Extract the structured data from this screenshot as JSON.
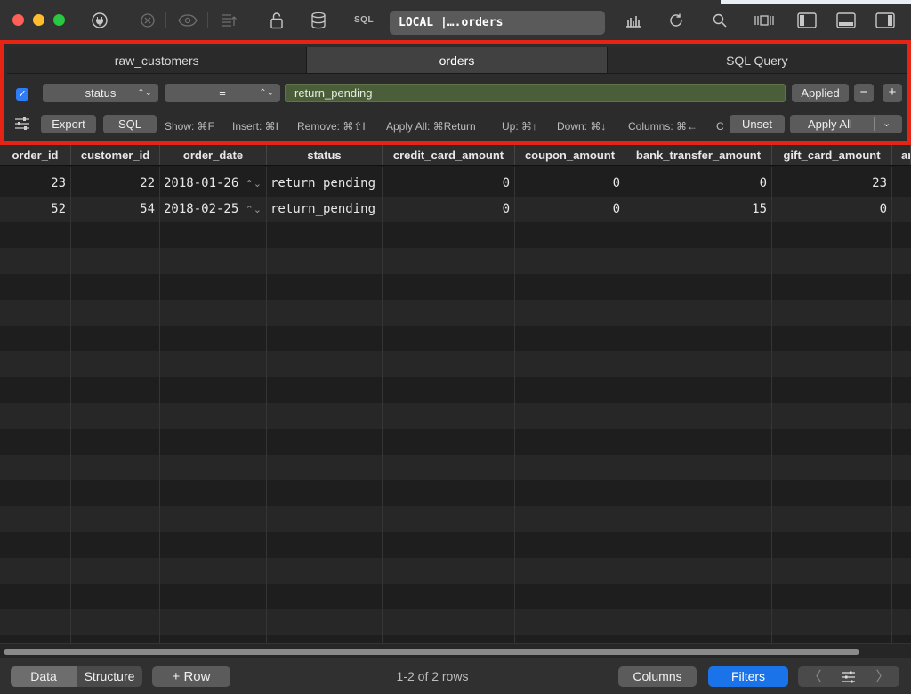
{
  "toolbar": {
    "sql_label": "SQL",
    "connection": "LOCAL |….orders"
  },
  "tabs": [
    {
      "label": "raw_customers",
      "active": false
    },
    {
      "label": "orders",
      "active": true
    },
    {
      "label": "SQL Query",
      "active": false
    }
  ],
  "filter": {
    "enabled": true,
    "field": "status",
    "operator": "=",
    "value": "return_pending",
    "applied_label": "Applied",
    "minus_label": "−",
    "plus_label": "+"
  },
  "shortcuts": {
    "export_label": "Export",
    "sql_label": "SQL",
    "show": "Show: ⌘F",
    "insert": "Insert: ⌘I",
    "remove": "Remove: ⌘⇧I",
    "apply_all": "Apply All: ⌘Return",
    "up": "Up: ⌘↑",
    "down": "Down: ⌘↓",
    "columns": "Columns: ⌘←",
    "truncated": "C",
    "unset_label": "Unset",
    "apply_all_label": "Apply All"
  },
  "table": {
    "columns": [
      "order_id",
      "customer_id",
      "order_date",
      "status",
      "credit_card_amount",
      "coupon_amount",
      "bank_transfer_amount",
      "gift_card_amount",
      "ar"
    ],
    "rows": [
      {
        "order_id": "23",
        "customer_id": "22",
        "order_date": "2018-01-26",
        "status": "return_pending",
        "credit_card_amount": "0",
        "coupon_amount": "0",
        "bank_transfer_amount": "0",
        "gift_card_amount": "23"
      },
      {
        "order_id": "52",
        "customer_id": "54",
        "order_date": "2018-02-25",
        "status": "return_pending",
        "credit_card_amount": "0",
        "coupon_amount": "0",
        "bank_transfer_amount": "15",
        "gift_card_amount": "0"
      }
    ]
  },
  "bottom": {
    "data_label": "Data",
    "structure_label": "Structure",
    "add_row_label": "+  Row",
    "row_count": "1-2 of 2 rows",
    "columns_label": "Columns",
    "filters_label": "Filters"
  },
  "colors": {
    "highlight_border": "#e52416",
    "accent_blue": "#1a73e8",
    "filter_value_bg": "#4b5e3a"
  }
}
